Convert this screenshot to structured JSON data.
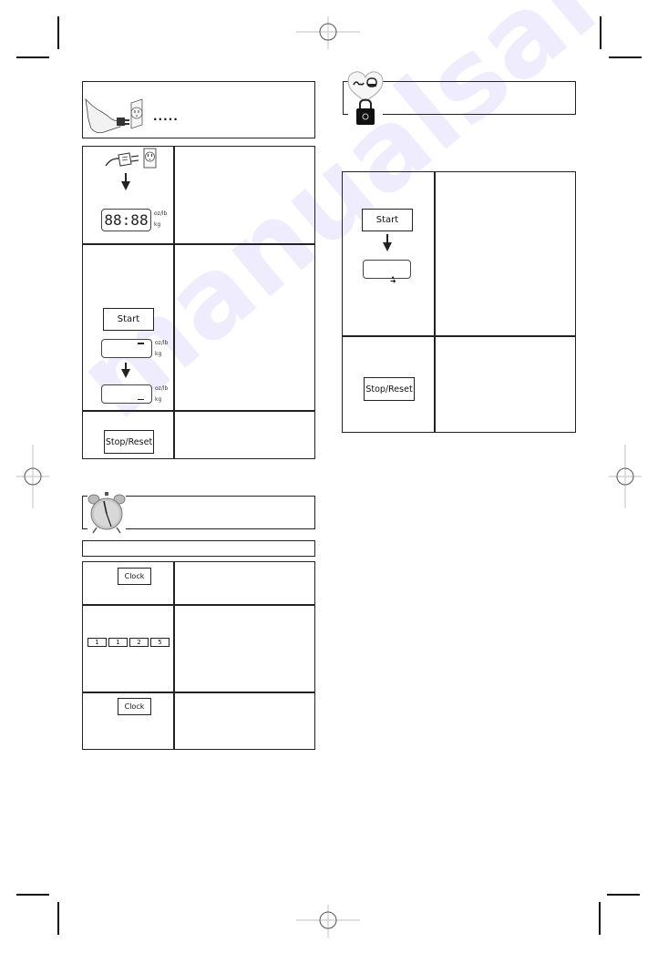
{
  "page": {
    "background": "#ffffff",
    "line_color": "#222222",
    "watermark_color": "#786ef0"
  },
  "watermark": {
    "text": "manualsarchive.com"
  },
  "left_column": {
    "power_section": {
      "header_icon": "hand-plugging-outlet-icon",
      "header_dots": "....."
    },
    "plug_in_step": {
      "icons": [
        "plug-icon",
        "outlet-icon",
        "arrow-down-icon"
      ],
      "display_text": "88:88",
      "display_units": [
        "oz/lb",
        "kg"
      ]
    },
    "start_step": {
      "button_label": "Start",
      "display_units": [
        "oz/lb",
        "kg"
      ]
    },
    "stop_step": {
      "button_label": "Stop/Reset"
    },
    "clock_section": {
      "header_icon": "alarm-clock-icon",
      "subheader_text": ""
    },
    "clock_steps": [
      {
        "button_label": "Clock"
      },
      {
        "number_keys": [
          "1",
          "1",
          "2",
          "5"
        ]
      },
      {
        "button_label": "Clock"
      }
    ]
  },
  "right_column": {
    "child_lock_section": {
      "header_icon": "child-lock-icon"
    },
    "start_step": {
      "button_label": "Start",
      "display_indicator": "lock-indicator-icon"
    },
    "stop_step": {
      "button_label": "Stop/Reset"
    }
  }
}
